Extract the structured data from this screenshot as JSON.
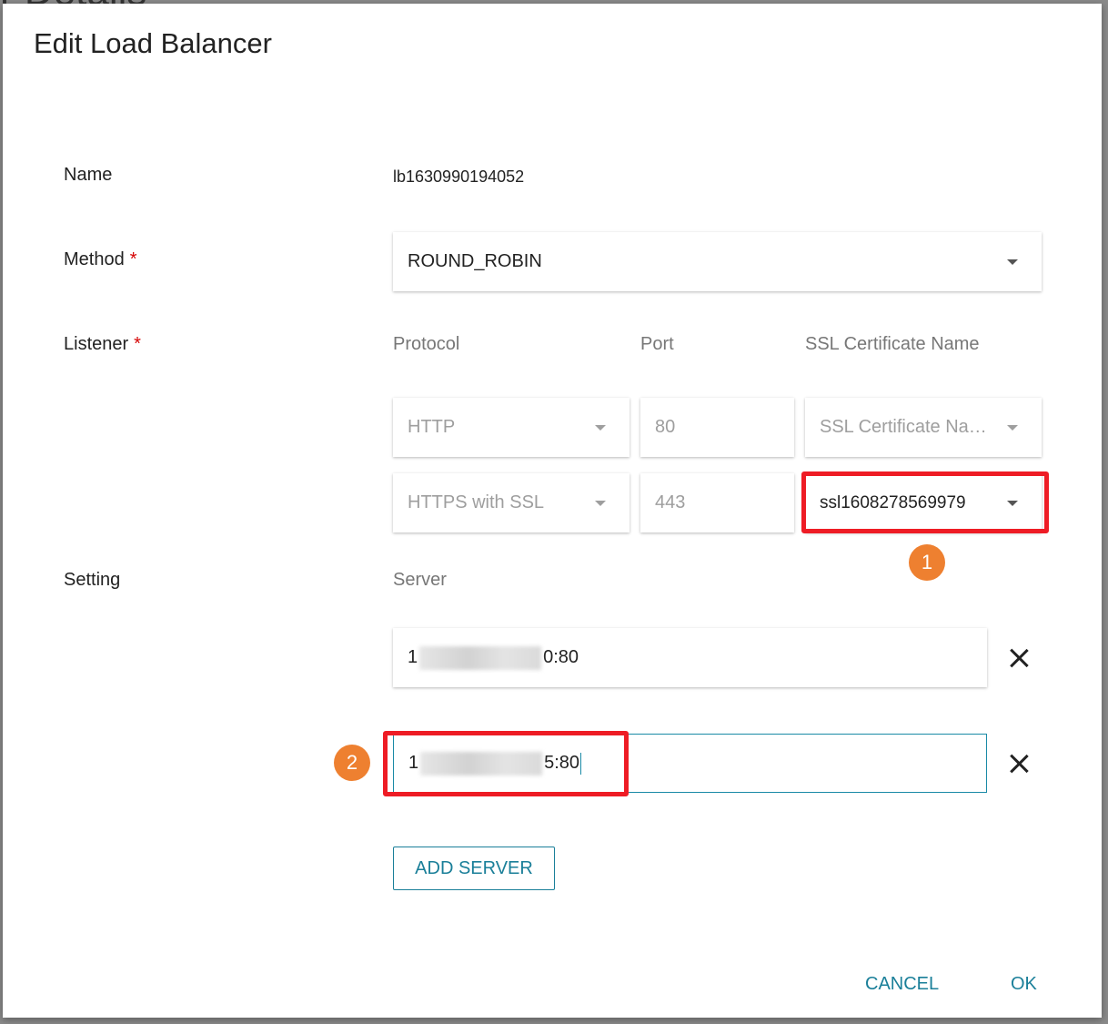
{
  "background": {
    "partial_title": "r Details"
  },
  "dialog": {
    "title": "Edit Load Balancer",
    "name": {
      "label": "Name",
      "value": "lb1630990194052"
    },
    "method": {
      "label": "Method",
      "required": "*",
      "value": "ROUND_ROBIN"
    },
    "listener": {
      "label": "Listener",
      "required": "*",
      "headers": {
        "protocol": "Protocol",
        "port": "Port",
        "ssl": "SSL Certificate Name"
      },
      "rows": [
        {
          "protocol": "HTTP",
          "port": "80",
          "ssl": "SSL Certificate Na…"
        },
        {
          "protocol": "HTTPS with SSL",
          "port": "443",
          "ssl": "ssl1608278569979"
        }
      ]
    },
    "setting": {
      "label": "Setting",
      "server_header": "Server",
      "servers": [
        {
          "prefix": "1",
          "suffix": "0:80"
        },
        {
          "prefix": "1",
          "suffix": "5:80"
        }
      ],
      "add_server_label": "ADD SERVER"
    },
    "actions": {
      "cancel": "CANCEL",
      "ok": "OK"
    },
    "annotations": {
      "badge_1": "1",
      "badge_2": "2"
    }
  },
  "colors": {
    "accent": "#1a7f99",
    "required": "#d50000",
    "highlight": "#ee1c25",
    "badge": "#ee8030"
  }
}
